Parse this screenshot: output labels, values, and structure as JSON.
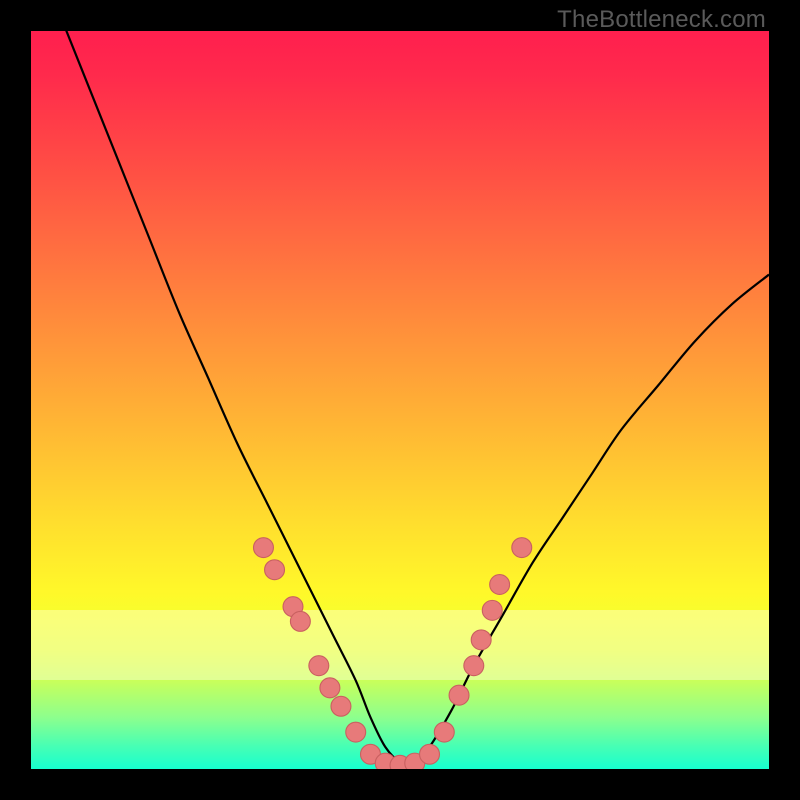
{
  "attribution": "TheBottleneck.com",
  "colors": {
    "frame": "#000000",
    "curve": "#000000",
    "dot_fill": "#e77a7a",
    "dot_stroke": "#c96060",
    "gradient_top": "#ff1f4e",
    "gradient_bottom": "#17ffcf"
  },
  "chart_data": {
    "type": "line",
    "title": "",
    "xlabel": "",
    "ylabel": "",
    "xlim": [
      0,
      100
    ],
    "ylim": [
      0,
      100
    ],
    "series": [
      {
        "name": "bottleneck-curve",
        "x": [
          4,
          8,
          12,
          16,
          20,
          24,
          28,
          32,
          35,
          38,
          41,
          44,
          46,
          48,
          50,
          52,
          54,
          57,
          60,
          64,
          68,
          72,
          76,
          80,
          85,
          90,
          95,
          100
        ],
        "y": [
          102,
          92,
          82,
          72,
          62,
          53,
          44,
          36,
          30,
          24,
          18,
          12,
          7,
          3,
          1,
          1,
          3,
          8,
          14,
          21,
          28,
          34,
          40,
          46,
          52,
          58,
          63,
          67
        ]
      }
    ],
    "points": [
      {
        "name": "left-dots",
        "xy": [
          [
            31.5,
            30.0
          ],
          [
            33.0,
            27.0
          ],
          [
            35.5,
            22.0
          ],
          [
            36.5,
            20.0
          ],
          [
            39.0,
            14.0
          ],
          [
            40.5,
            11.0
          ],
          [
            42.0,
            8.5
          ],
          [
            44.0,
            5.0
          ]
        ]
      },
      {
        "name": "bottom-dots",
        "xy": [
          [
            46.0,
            2.0
          ],
          [
            48.0,
            0.8
          ],
          [
            50.0,
            0.5
          ],
          [
            52.0,
            0.8
          ],
          [
            54.0,
            2.0
          ]
        ]
      },
      {
        "name": "right-dots",
        "xy": [
          [
            56.0,
            5.0
          ],
          [
            58.0,
            10.0
          ],
          [
            60.0,
            14.0
          ],
          [
            61.0,
            17.5
          ],
          [
            62.5,
            21.5
          ],
          [
            63.5,
            25.0
          ],
          [
            66.5,
            30.0
          ]
        ]
      }
    ]
  }
}
